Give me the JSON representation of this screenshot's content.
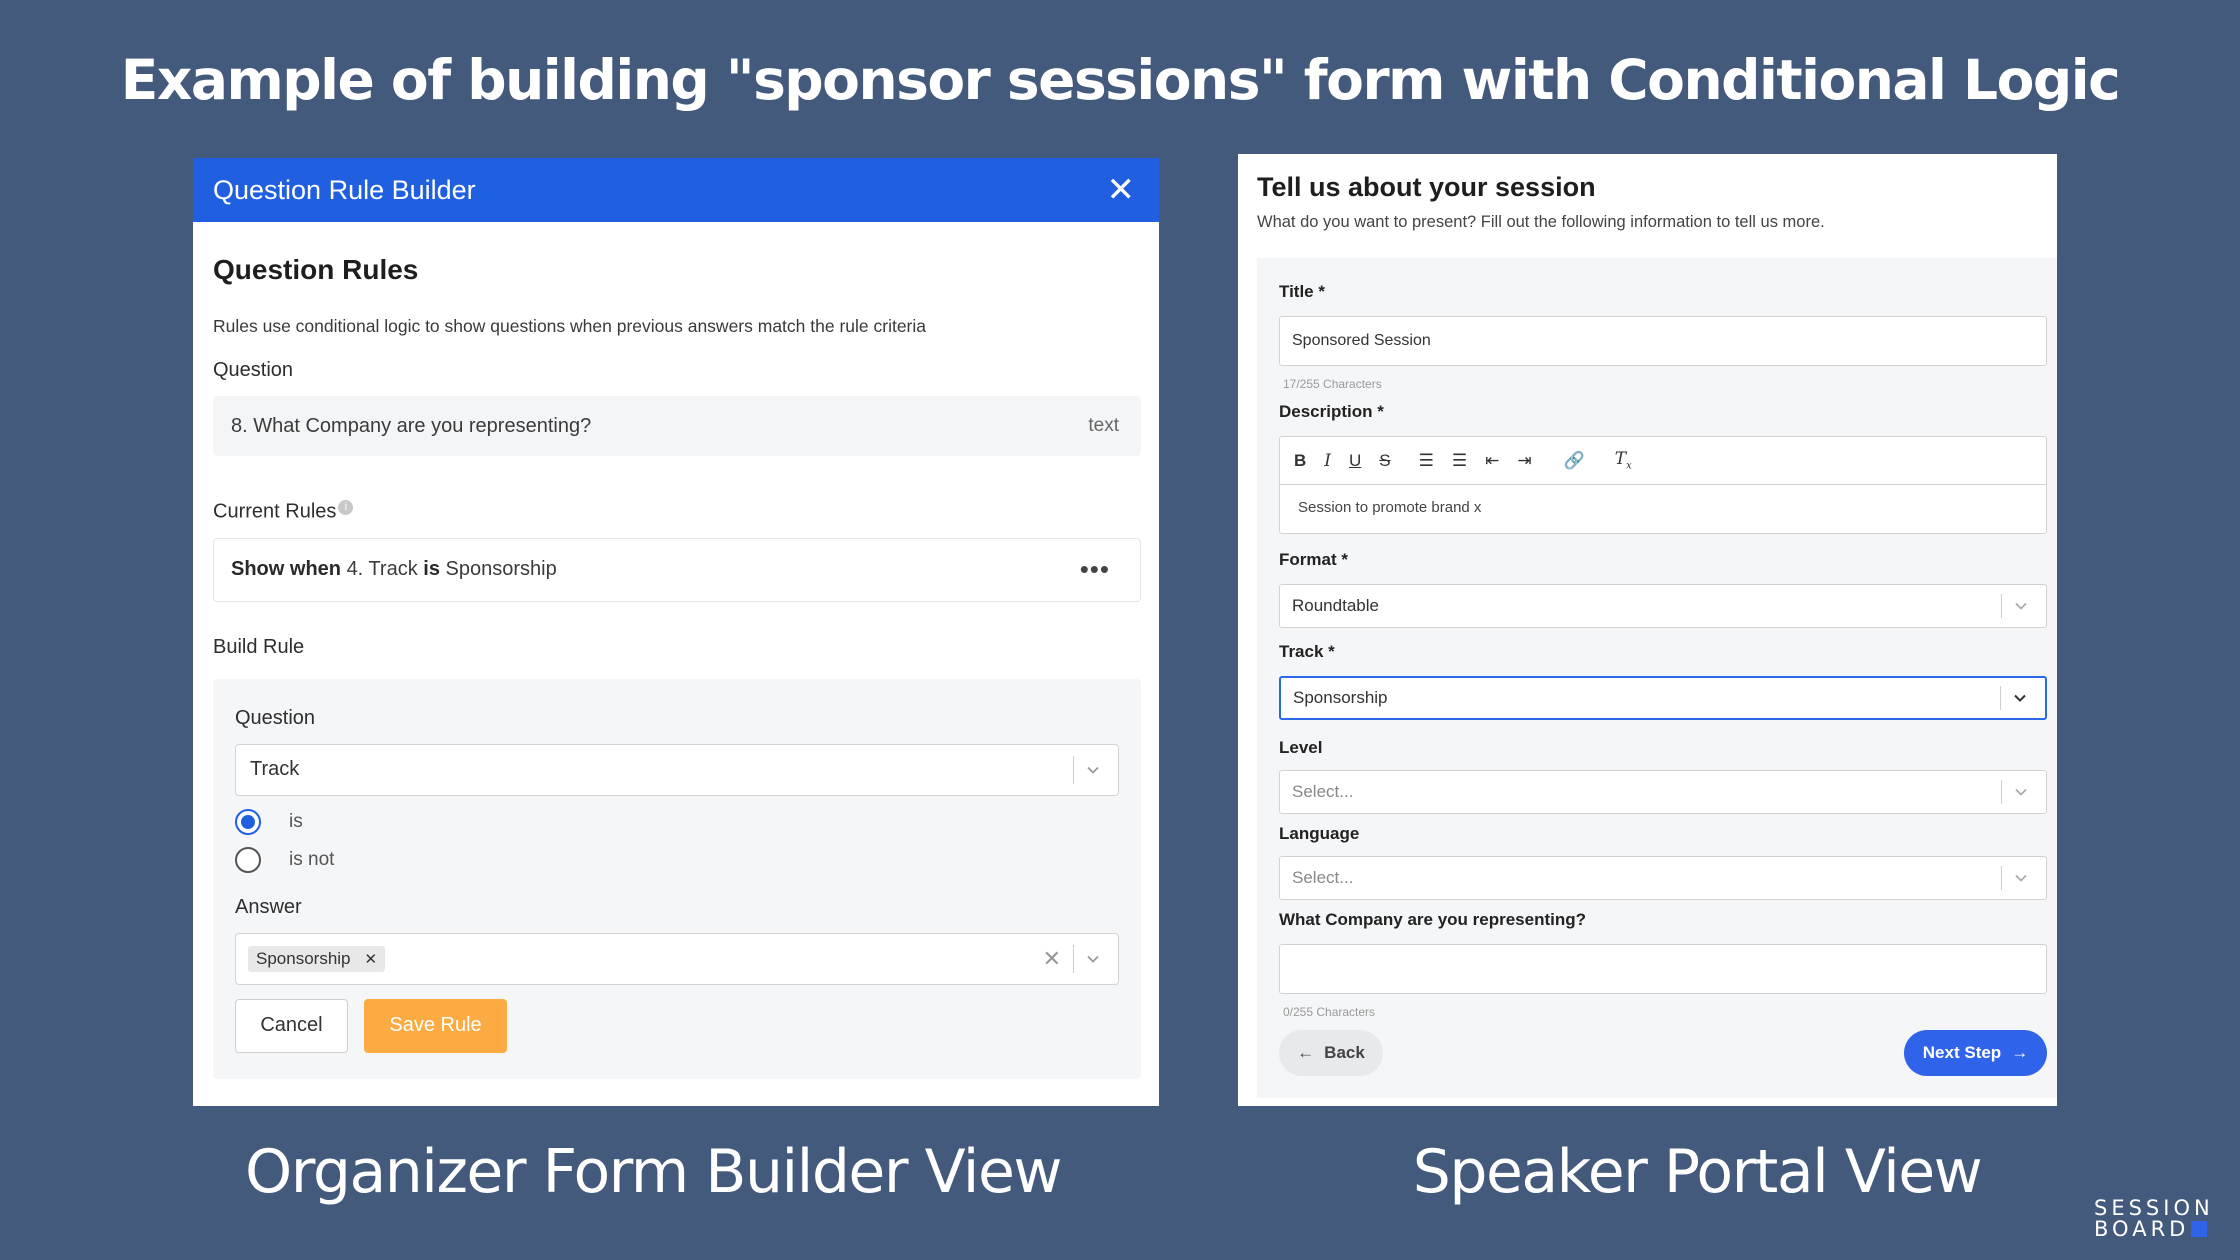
{
  "headline": "Example of building \"sponsor sessions\" form with Conditional Logic",
  "captions": {
    "left": "Organizer Form Builder View",
    "right": "Speaker Portal View"
  },
  "builder": {
    "header_title": "Question Rule Builder",
    "section_title": "Question Rules",
    "description": "Rules use conditional logic to show questions when previous answers match the rule criteria",
    "question_label": "Question",
    "question_text": "8. What Company are you representing?",
    "question_type": "text",
    "current_rules_label": "Current Rules",
    "rule": {
      "show_when": "Show when",
      "question": "4. Track",
      "is": "is",
      "value": "Sponsorship"
    },
    "build_rule_label": "Build Rule",
    "build": {
      "question_label": "Question",
      "question_value": "Track",
      "option_is": "is",
      "option_is_not": "is not",
      "answer_label": "Answer",
      "answer_chip": "Sponsorship"
    },
    "cancel_label": "Cancel",
    "save_label": "Save Rule"
  },
  "portal": {
    "title": "Tell us about your session",
    "subtitle": "What do you want to present? Fill out the following information to tell us more.",
    "title_label": "Title *",
    "title_value": "Sponsored Session",
    "title_count": "17/255 Characters",
    "description_label": "Description *",
    "description_value": "Session to promote brand x",
    "format_label": "Format *",
    "format_value": "Roundtable",
    "track_label": "Track *",
    "track_value": "Sponsorship",
    "level_label": "Level",
    "level_placeholder": "Select...",
    "language_label": "Language",
    "language_placeholder": "Select...",
    "company_label": "What Company are you representing?",
    "company_count": "0/255 Characters",
    "back_label": "Back",
    "next_label": "Next Step"
  },
  "logo": {
    "line1": "SESSION",
    "line2": "BOARD"
  },
  "colors": {
    "background": "#445a7c",
    "header_blue": "#1f5fe0",
    "save_orange": "#fbab42",
    "next_blue": "#2f63ea"
  }
}
